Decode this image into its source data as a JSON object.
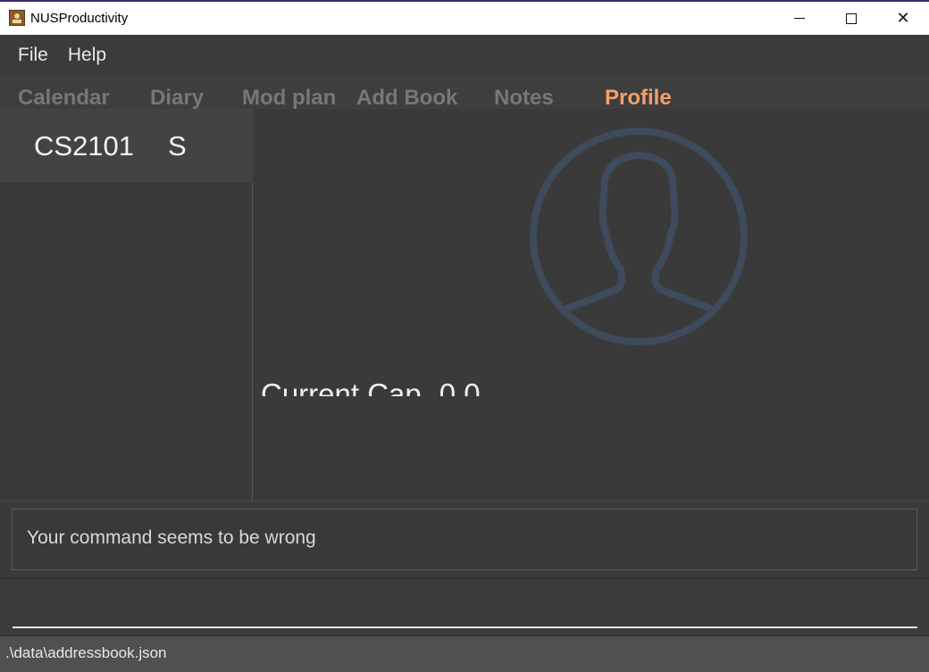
{
  "window": {
    "title": "NUSProductivity",
    "icon": "app-icon",
    "controls": [
      "minimize",
      "maximize",
      "close"
    ]
  },
  "menu": {
    "items": [
      {
        "label": "File"
      },
      {
        "label": "Help"
      }
    ]
  },
  "tabs": [
    {
      "label": "Calendar",
      "active": false
    },
    {
      "label": "Diary",
      "active": false
    },
    {
      "label": "Mod plan",
      "active": false
    },
    {
      "label": "Add Book",
      "active": false
    },
    {
      "label": "Notes",
      "active": false
    },
    {
      "label": "Profile",
      "active": true
    }
  ],
  "modules": [
    {
      "code": "CS2101",
      "grade": "S"
    }
  ],
  "profile": {
    "avatar_icon": "user-avatar-icon",
    "cap_label": "Current Cap",
    "cap_value": "0.0"
  },
  "result": {
    "message": "Your command seems to be wrong"
  },
  "command": {
    "value": "",
    "placeholder": ""
  },
  "status": {
    "path": ".\\data\\addressbook.json"
  },
  "colors": {
    "active_tab": "#f4a06b",
    "inactive_tab": "#777777",
    "background": "#3a3a3a",
    "avatar_stroke": "#3d4b5c"
  }
}
